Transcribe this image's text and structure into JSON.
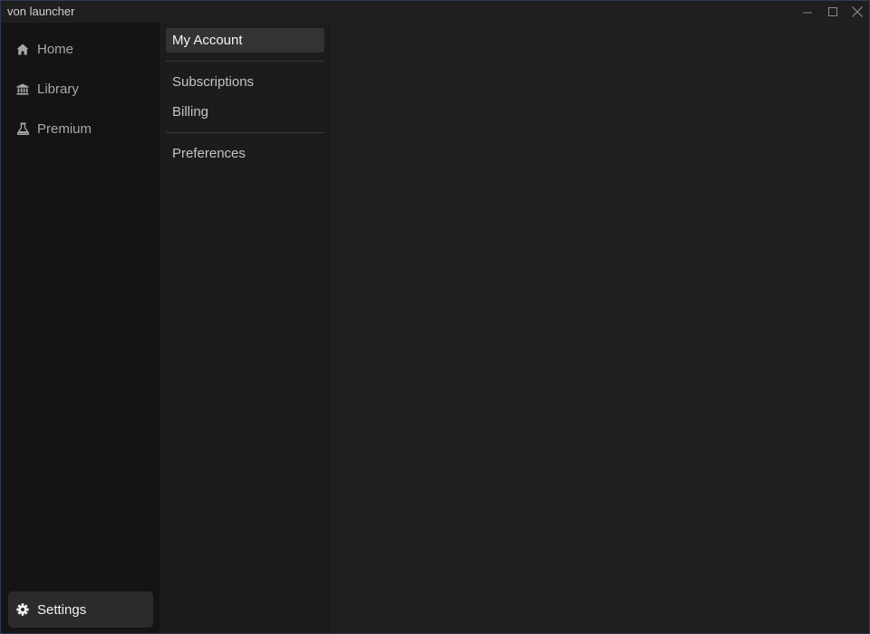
{
  "window": {
    "title": "von launcher",
    "border_color": "#2c3a52"
  },
  "sidebar": {
    "items": [
      {
        "label": "Home",
        "icon": "home-icon"
      },
      {
        "label": "Library",
        "icon": "library-icon"
      },
      {
        "label": "Premium",
        "icon": "flask-icon"
      },
      {
        "label": "Settings",
        "icon": "gear-icon",
        "active": true
      }
    ]
  },
  "settings_menu": {
    "items": [
      {
        "label": "My Account",
        "active": true
      },
      {
        "label": "Subscriptions"
      },
      {
        "label": "Billing"
      },
      {
        "label": "Preferences"
      }
    ]
  },
  "colors": {
    "sidebar_bg": "#141414",
    "submenu_bg": "#1c1c1c",
    "content_bg": "#1f1f1f",
    "active_item_bg": "#333333"
  }
}
